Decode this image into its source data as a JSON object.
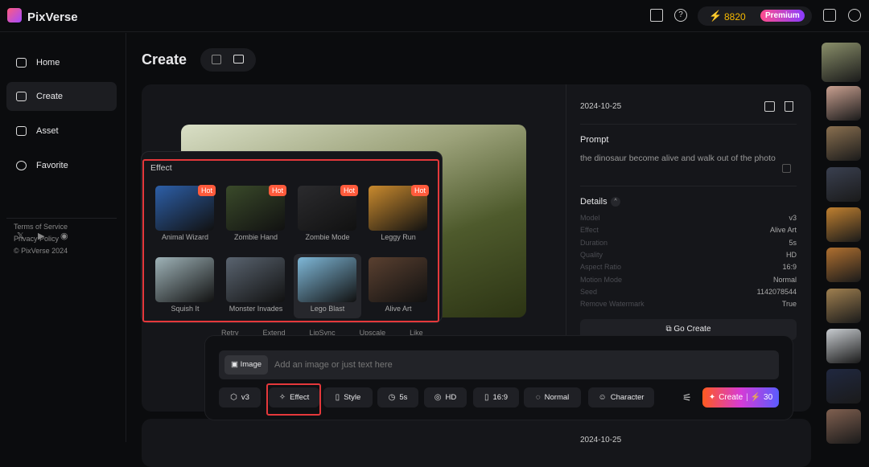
{
  "header": {
    "brand": "PixVerse",
    "credits": "8820",
    "plan": "Premium",
    "icons": [
      "book-icon",
      "help-icon",
      "lightning-icon",
      "feedback-icon",
      "user-icon"
    ]
  },
  "sidebar": {
    "items": [
      {
        "label": "Home",
        "icon": "home-icon"
      },
      {
        "label": "Create",
        "icon": "video-icon",
        "active": true
      },
      {
        "label": "Asset",
        "icon": "folder-icon"
      },
      {
        "label": "Favorite",
        "icon": "heart-icon"
      }
    ],
    "social": [
      "x-icon",
      "youtube-icon",
      "discord-icon"
    ],
    "footer": [
      "Terms of Service",
      "Privacy Policy",
      "© PixVerse 2024"
    ]
  },
  "page": {
    "title": "Create"
  },
  "detail": {
    "date": "2024-10-25",
    "prompt_label": "Prompt",
    "prompt": "the dinosaur become alive and walk out of the photo",
    "details_label": "Details",
    "rows": [
      {
        "k": "Model",
        "v": "v3"
      },
      {
        "k": "Effect",
        "v": "Alive Art"
      },
      {
        "k": "Duration",
        "v": "5s"
      },
      {
        "k": "Quality",
        "v": "HD"
      },
      {
        "k": "Aspect Ratio",
        "v": "16:9"
      },
      {
        "k": "Motion Mode",
        "v": "Normal"
      },
      {
        "k": "Seed",
        "v": "1142078544"
      },
      {
        "k": "Remove Watermark",
        "v": "True"
      }
    ],
    "go_create": "Go Create"
  },
  "actions": [
    "Retry",
    "Extend",
    "LipSync",
    "Upscale",
    "Like"
  ],
  "effect_popup": {
    "title": "Effect",
    "items": [
      {
        "label": "Animal Wizard",
        "hot": "Hot",
        "color": "#2d5fa8"
      },
      {
        "label": "Zombie Hand",
        "hot": "Hot",
        "color": "#3a4a2a"
      },
      {
        "label": "Zombie Mode",
        "hot": "Hot",
        "color": "#2b2b2e"
      },
      {
        "label": "Leggy Run",
        "hot": "Hot",
        "color": "#c98a2e"
      },
      {
        "label": "Squish It",
        "color": "#9fb3b8"
      },
      {
        "label": "Monster Invades",
        "color": "#5a6470"
      },
      {
        "label": "Lego Blast",
        "color": "#7fb8d8",
        "selected": true
      },
      {
        "label": "Alive Art",
        "color": "#5a4030"
      }
    ]
  },
  "composer": {
    "image_label": "Image",
    "placeholder": "Add an image or just text here",
    "options": [
      {
        "label": "v3",
        "icon": "cube-icon"
      },
      {
        "label": "Effect",
        "icon": "sparkle-icon"
      },
      {
        "label": "Style",
        "icon": "style-icon"
      },
      {
        "label": "5s",
        "icon": "clock-icon"
      },
      {
        "label": "HD",
        "icon": "hd-icon"
      },
      {
        "label": "16:9",
        "icon": "ratio-icon"
      },
      {
        "label": "Normal",
        "icon": "motion-icon"
      },
      {
        "label": "Character",
        "icon": "face-icon"
      }
    ],
    "create_label": "Create",
    "create_cost": "30"
  },
  "history_colors": [
    "#8a8f6a",
    "#c9a090",
    "#8a7050",
    "#3a4050",
    "#c08030",
    "#b07030",
    "#a08050",
    "#c8ccd0",
    "#202840",
    "#806050"
  ],
  "second_card_date": "2024-10-25"
}
